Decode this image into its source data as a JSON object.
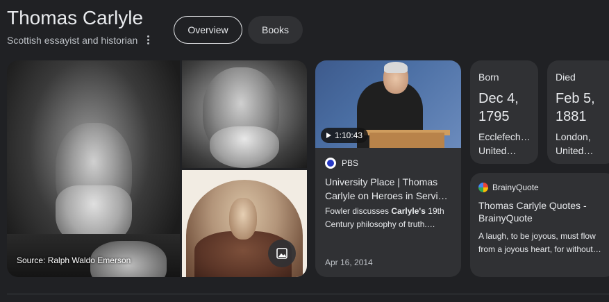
{
  "header": {
    "title": "Thomas Carlyle",
    "subtitle": "Scottish essayist and historian"
  },
  "tabs": [
    {
      "label": "Overview",
      "selected": true
    },
    {
      "label": "Books",
      "selected": false
    }
  ],
  "images": {
    "main_source": "Source: Ralph Waldo Emerson"
  },
  "video": {
    "duration": "1:10:43",
    "source": "PBS",
    "title": "University Place | Thomas Carlyle on Heroes in Servi…",
    "snippet_pre": "Fowler discusses ",
    "snippet_bold": "Carlyle's",
    "snippet_post": " 19th Century philosophy of truth.…",
    "date": "Apr 16, 2014"
  },
  "born": {
    "label": "Born",
    "date": "Dec 4, 1795",
    "place_line1": "Ecclefech…",
    "place_line2": "United…"
  },
  "died": {
    "label": "Died",
    "date": "Feb 5, 1881",
    "place_line1": "London,",
    "place_line2": "United…"
  },
  "quote": {
    "source": "BrainyQuote",
    "title": "Thomas Carlyle Quotes - BrainyQuote",
    "text": "A laugh, to be joyous, must flow from a joyous heart, for without…"
  },
  "colors": {
    "background": "#202124",
    "card": "#303134",
    "text": "#e8eaed",
    "secondary_text": "#bdc1c6"
  }
}
